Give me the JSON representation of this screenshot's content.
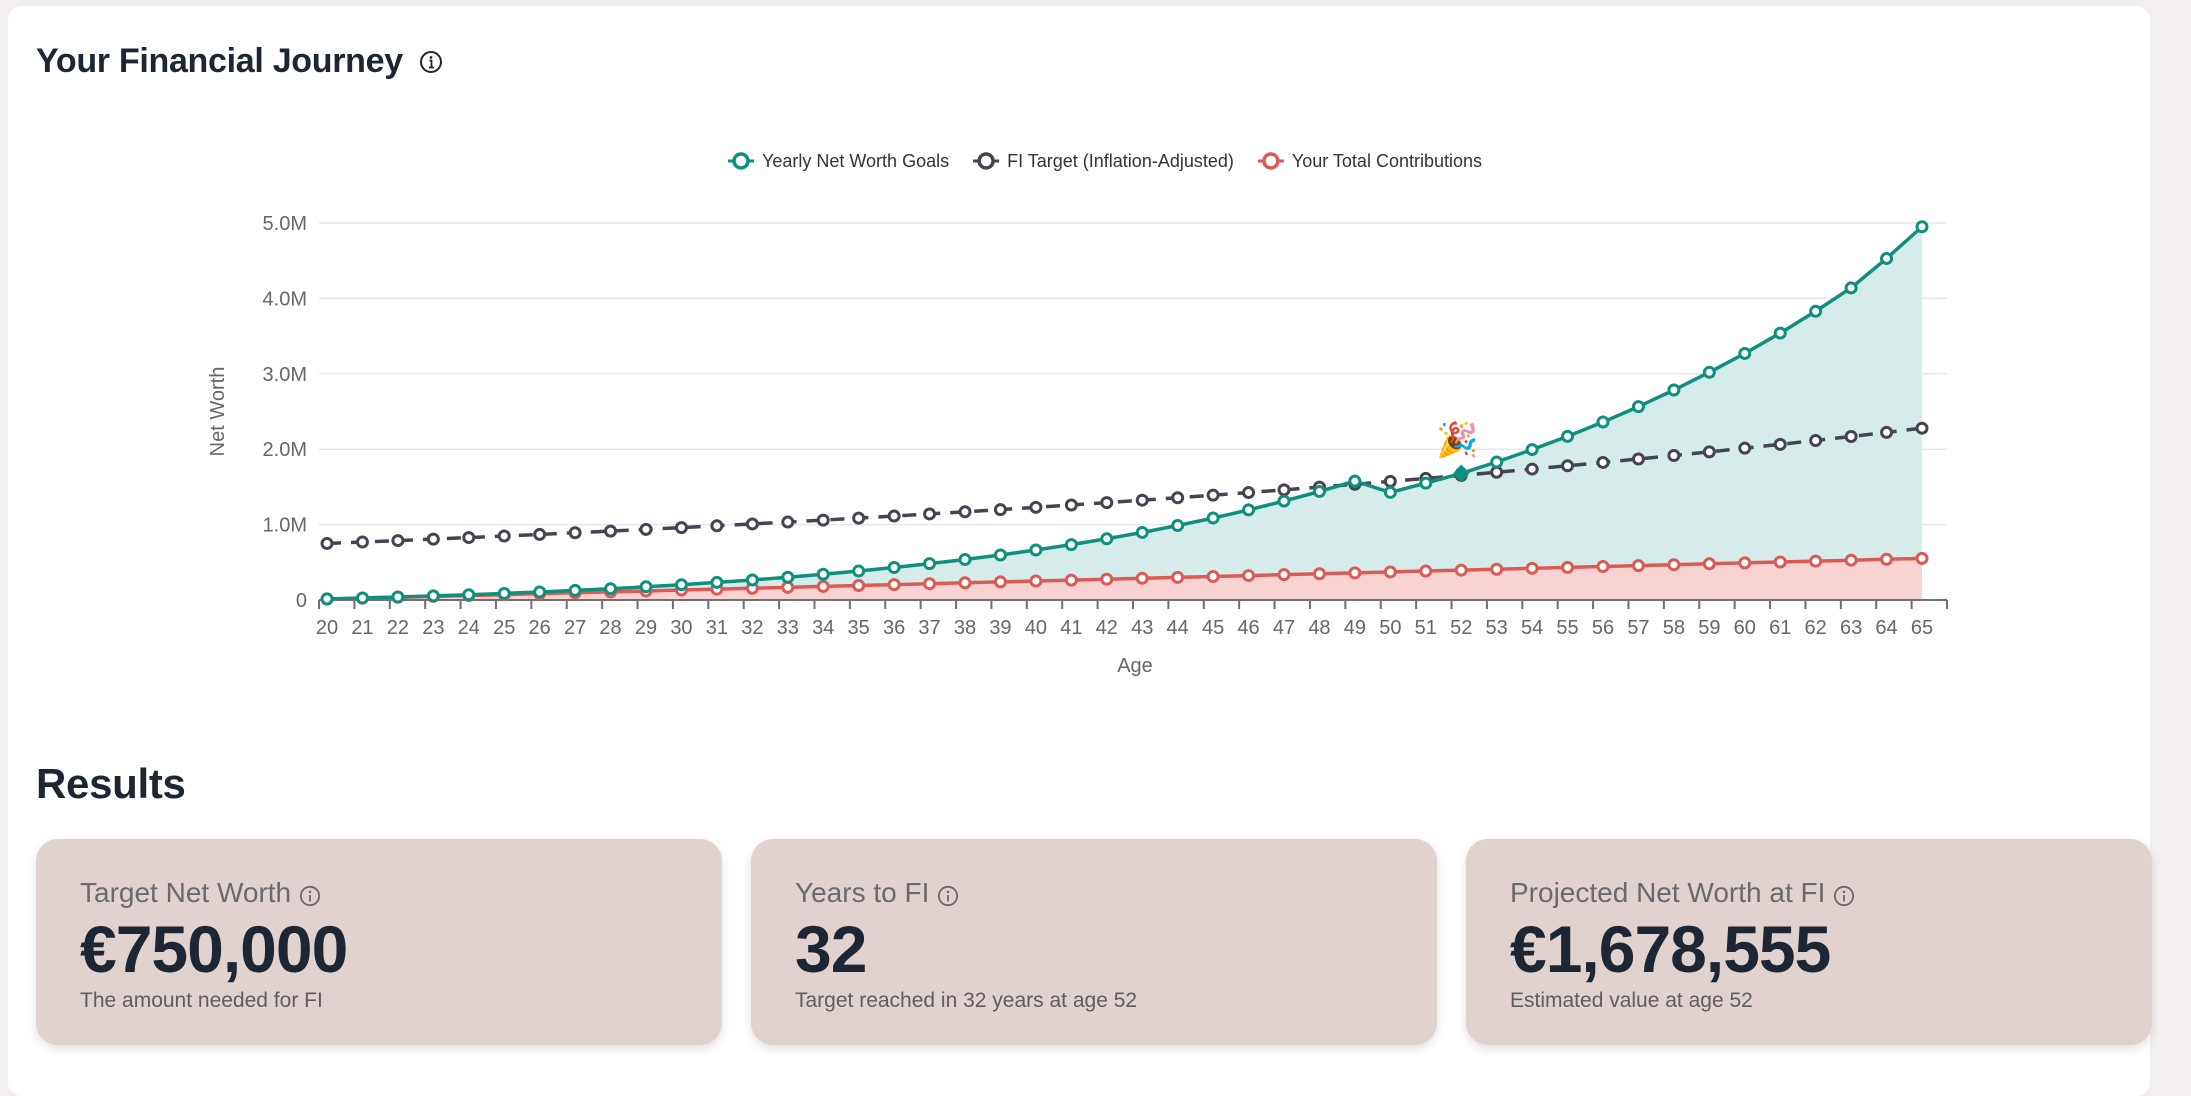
{
  "header": {
    "title": "Your Financial Journey",
    "info_icon": "info-circle-icon"
  },
  "chart_data": {
    "type": "line",
    "title": "",
    "xlabel": "Age",
    "ylabel": "Net Worth",
    "ylim": [
      0,
      5000000
    ],
    "yticks": [
      0,
      1000000,
      2000000,
      3000000,
      4000000,
      5000000
    ],
    "ytick_labels": [
      "0",
      "1.0M",
      "2.0M",
      "3.0M",
      "4.0M",
      "5.0M"
    ],
    "grid": true,
    "legend_position": "top-center",
    "x": [
      20,
      21,
      22,
      23,
      24,
      25,
      26,
      27,
      28,
      29,
      30,
      31,
      32,
      33,
      34,
      35,
      36,
      37,
      38,
      39,
      40,
      41,
      42,
      43,
      44,
      45,
      46,
      47,
      48,
      49,
      50,
      51,
      52,
      53,
      54,
      55,
      56,
      57,
      58,
      59,
      60,
      61,
      62,
      63,
      64,
      65
    ],
    "series": [
      {
        "name": "Yearly Net Worth Goals",
        "color": "#0f8f7e",
        "fill": "#d5ecea",
        "style": "solid",
        "values": [
          15000,
          27000,
          40000,
          54000,
          70000,
          87000,
          106000,
          127000,
          150000,
          175000,
          203000,
          233000,
          266000,
          302000,
          341000,
          384000,
          431000,
          482000,
          537000,
          597000,
          663000,
          734000,
          812000,
          896000,
          988000,
          1087000,
          1195000,
          1312000,
          1439000,
          1577000,
          1427000,
          1550000,
          1678555,
          1830000,
          1995000,
          2170000,
          2360000,
          2565000,
          2785000,
          3020000,
          3270000,
          3540000,
          3830000,
          4140000,
          4530000,
          4950000
        ]
      },
      {
        "name": "FI Target (Inflation-Adjusted)",
        "color": "#454552",
        "style": "dashed",
        "values": [
          750000,
          768750,
          787969,
          807668,
          827860,
          848556,
          869770,
          891514,
          913802,
          936647,
          960063,
          984064,
          1008666,
          1033882,
          1059729,
          1086222,
          1113378,
          1141212,
          1169743,
          1198986,
          1228961,
          1259685,
          1291177,
          1323456,
          1356543,
          1390456,
          1425218,
          1460848,
          1497370,
          1534804,
          1573174,
          1612503,
          1652816,
          1694136,
          1736489,
          1779902,
          1824399,
          1870009,
          1916760,
          1964679,
          2013796,
          2064141,
          2115745,
          2168638,
          2222854,
          2278426
        ]
      },
      {
        "name": "Your Total Contributions",
        "color": "#dc5a55",
        "fill": "#f8d3d1",
        "style": "solid",
        "values": [
          12000,
          24000,
          36000,
          48000,
          60000,
          72000,
          84000,
          96000,
          108000,
          120000,
          132000,
          144000,
          156000,
          168000,
          180000,
          192000,
          204000,
          216000,
          228000,
          240000,
          252000,
          264000,
          276000,
          288000,
          300000,
          312000,
          324000,
          336000,
          348000,
          360000,
          372000,
          384000,
          396000,
          408000,
          420000,
          432000,
          444000,
          456000,
          468000,
          480000,
          492000,
          504000,
          516000,
          528000,
          540000,
          552000
        ]
      }
    ],
    "annotations": [
      {
        "type": "marker",
        "x": 52,
        "y": 1678555,
        "label": "🎉",
        "note": "FI reached"
      }
    ]
  },
  "results": {
    "title": "Results",
    "cards": [
      {
        "label": "Target Net Worth",
        "value": "€750,000",
        "sub": "The amount needed for FI"
      },
      {
        "label": "Years to FI",
        "value": "32",
        "sub": "Target reached in 32 years at age 52"
      },
      {
        "label": "Projected Net Worth at FI",
        "value": "€1,678,555",
        "sub": "Estimated value at age 52"
      }
    ]
  }
}
